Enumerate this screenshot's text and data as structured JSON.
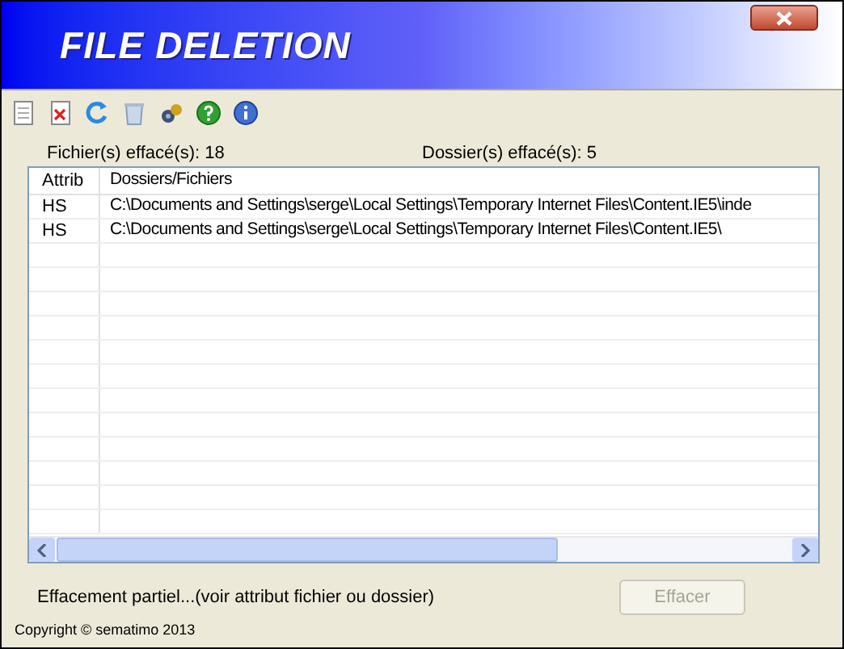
{
  "window": {
    "title": "FILE DELETION"
  },
  "toolbar": [
    {
      "kind": "new"
    },
    {
      "kind": "delete"
    },
    {
      "kind": "refresh"
    },
    {
      "kind": "trash"
    },
    {
      "kind": "tools"
    },
    {
      "kind": "help"
    },
    {
      "kind": "info"
    }
  ],
  "stats": [
    "Fichier(s) effacé(s): 18",
    "Dossier(s) effacé(s): 5"
  ],
  "table": {
    "columns": [
      "Attrib",
      "Dossiers/Fichiers"
    ],
    "rows": [
      [
        "HS",
        "C:\\Documents and Settings\\serge\\Local Settings\\Temporary Internet Files\\Content.IE5\\inde"
      ],
      [
        "HS",
        "C:\\Documents and Settings\\serge\\Local Settings\\Temporary Internet Files\\Content.IE5\\"
      ]
    ]
  },
  "status": "Effacement partiel...(voir attribut fichier ou dossier)",
  "button": {
    "label": "Effacer",
    "disabled": true
  },
  "copyright": "Copyright © sematimo 2013"
}
